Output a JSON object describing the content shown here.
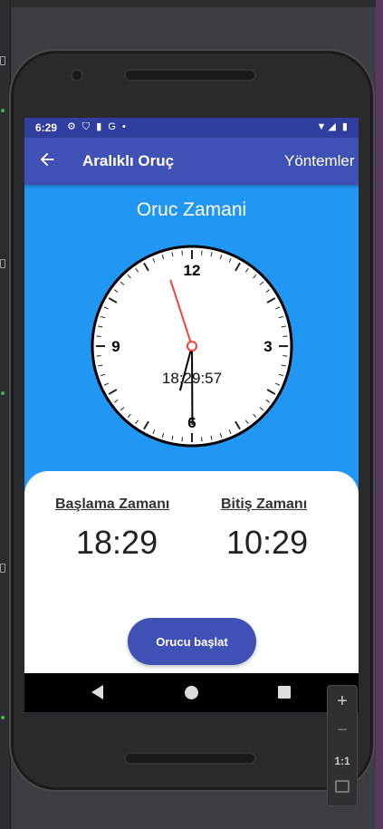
{
  "status_bar": {
    "time": "6:29",
    "left_icons": "⚙ ⛉ ▮ G •",
    "right_icons": "▼◢ ▮"
  },
  "app_bar": {
    "back_icon": "arrow-left-icon",
    "title": "Aralıklı Oruç",
    "action": "Yöntemler"
  },
  "main": {
    "title": "Oruc Zamani",
    "clock": {
      "numerals": [
        "12",
        "3",
        "6",
        "9"
      ],
      "digital_time": "18:29:57",
      "hour": 18,
      "minute": 29,
      "second": 57
    },
    "start_label": "Başlama Zamanı",
    "start_time": "18:29",
    "end_label": "Bitiş Zamanı",
    "end_time": "10:29",
    "start_button": "Orucu başlat"
  },
  "zoom_toolbar": {
    "zoom_in": "+",
    "zoom_out": "−",
    "ratio": "1:1"
  },
  "colors": {
    "primary": "#3f51b5",
    "primary_dark": "#303f9f",
    "clock_background": "#2196f3",
    "second_hand": "#f44336"
  }
}
